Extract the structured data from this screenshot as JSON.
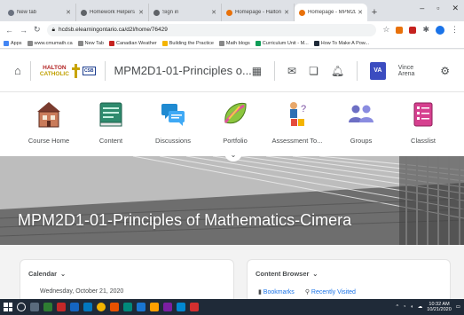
{
  "browser": {
    "tabs": [
      {
        "title": "New tab",
        "active": false
      },
      {
        "title": "Homework Helpers | HCDSB",
        "active": false
      },
      {
        "title": "Sign in",
        "active": false
      },
      {
        "title": "Homepage - Halton",
        "active": false
      },
      {
        "title": "Homepage - MPM2D1",
        "active": true
      }
    ],
    "new_tab": "+",
    "window_controls": [
      "–",
      "▫",
      "✕"
    ],
    "url": "hcdsb.elearningontario.ca/d2l/home/76429",
    "bookmarks": [
      "Apps",
      "www.cmumath.ca",
      "New Tab",
      "Canadian Weather",
      "Building the Practice",
      "Math blogs",
      "Curriculum Unit - M...",
      "How To Make A Pow..."
    ]
  },
  "navbar": {
    "logo_line1": "HALTON",
    "logo_line2": "CATHOLIC",
    "logo_badge": "CSB",
    "course_title": "MPM2D1-01-Principles o...",
    "user_initials": "VA",
    "user_name": "Vince Arena"
  },
  "course_nav": [
    {
      "label": "Course Home",
      "icon": "course-home-icon"
    },
    {
      "label": "Content",
      "icon": "content-icon"
    },
    {
      "label": "Discussions",
      "icon": "discussions-icon"
    },
    {
      "label": "Portfolio",
      "icon": "portfolio-icon"
    },
    {
      "label": "Assessment To...",
      "icon": "assessment-icon"
    },
    {
      "label": "Groups",
      "icon": "groups-icon"
    },
    {
      "label": "Classlist",
      "icon": "classlist-icon"
    }
  ],
  "banner": {
    "title": "MPM2D1-01-Principles of Mathematics-Cimera"
  },
  "widgets": {
    "calendar": {
      "title": "Calendar",
      "date": "Wednesday, October 21, 2020"
    },
    "content_browser": {
      "title": "Content Browser",
      "links": [
        "Bookmarks",
        "Recently Visited"
      ]
    }
  },
  "taskbar": {
    "time": "10:32 AM",
    "date": "10/21/2020"
  },
  "colors": {
    "accent": "#3b4cc0",
    "link": "#1a73e8",
    "text": "#494c4e"
  }
}
